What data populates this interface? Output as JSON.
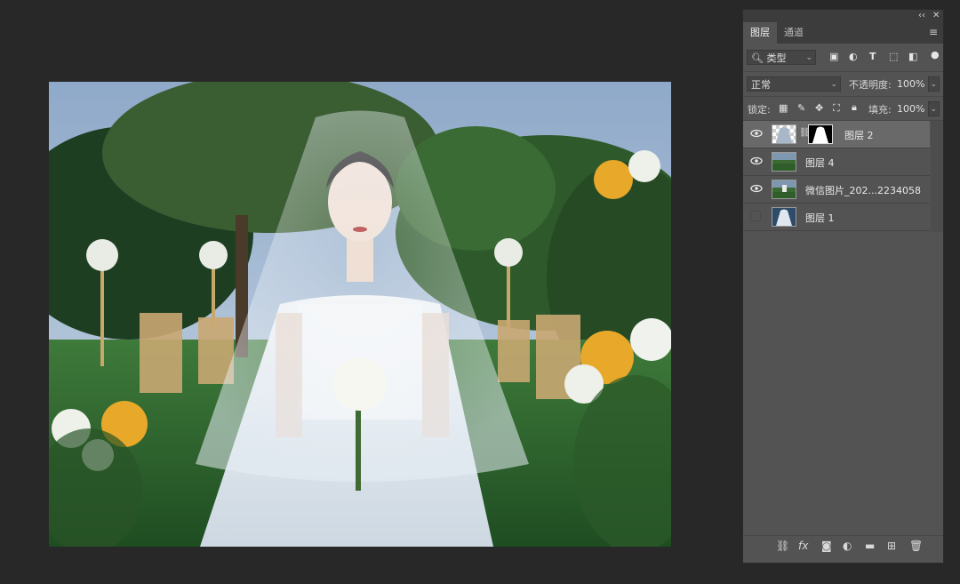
{
  "panel": {
    "topbar": {
      "collapse": "‹‹",
      "close": "✕"
    },
    "tabs": [
      "图层",
      "通道"
    ],
    "filter_kind": "类型",
    "blend_mode": "正常",
    "opacity_label": "不透明度:",
    "opacity_value": "100%",
    "lock_label": "锁定:",
    "fill_label": "填充:",
    "fill_value": "100%",
    "layers": [
      {
        "name": "图层 2",
        "visible": true,
        "selected": true
      },
      {
        "name": "图层 4",
        "visible": true,
        "selected": false
      },
      {
        "name": "微信图片_202...2234058",
        "visible": true,
        "selected": false
      },
      {
        "name": "图层 1",
        "visible": false,
        "selected": false
      }
    ],
    "bottom_icons": [
      "link-icon",
      "fx-icon",
      "mask-icon",
      "adjustment-icon",
      "folder-icon",
      "new-layer-icon",
      "trash-icon"
    ],
    "fx_text": "fx"
  }
}
